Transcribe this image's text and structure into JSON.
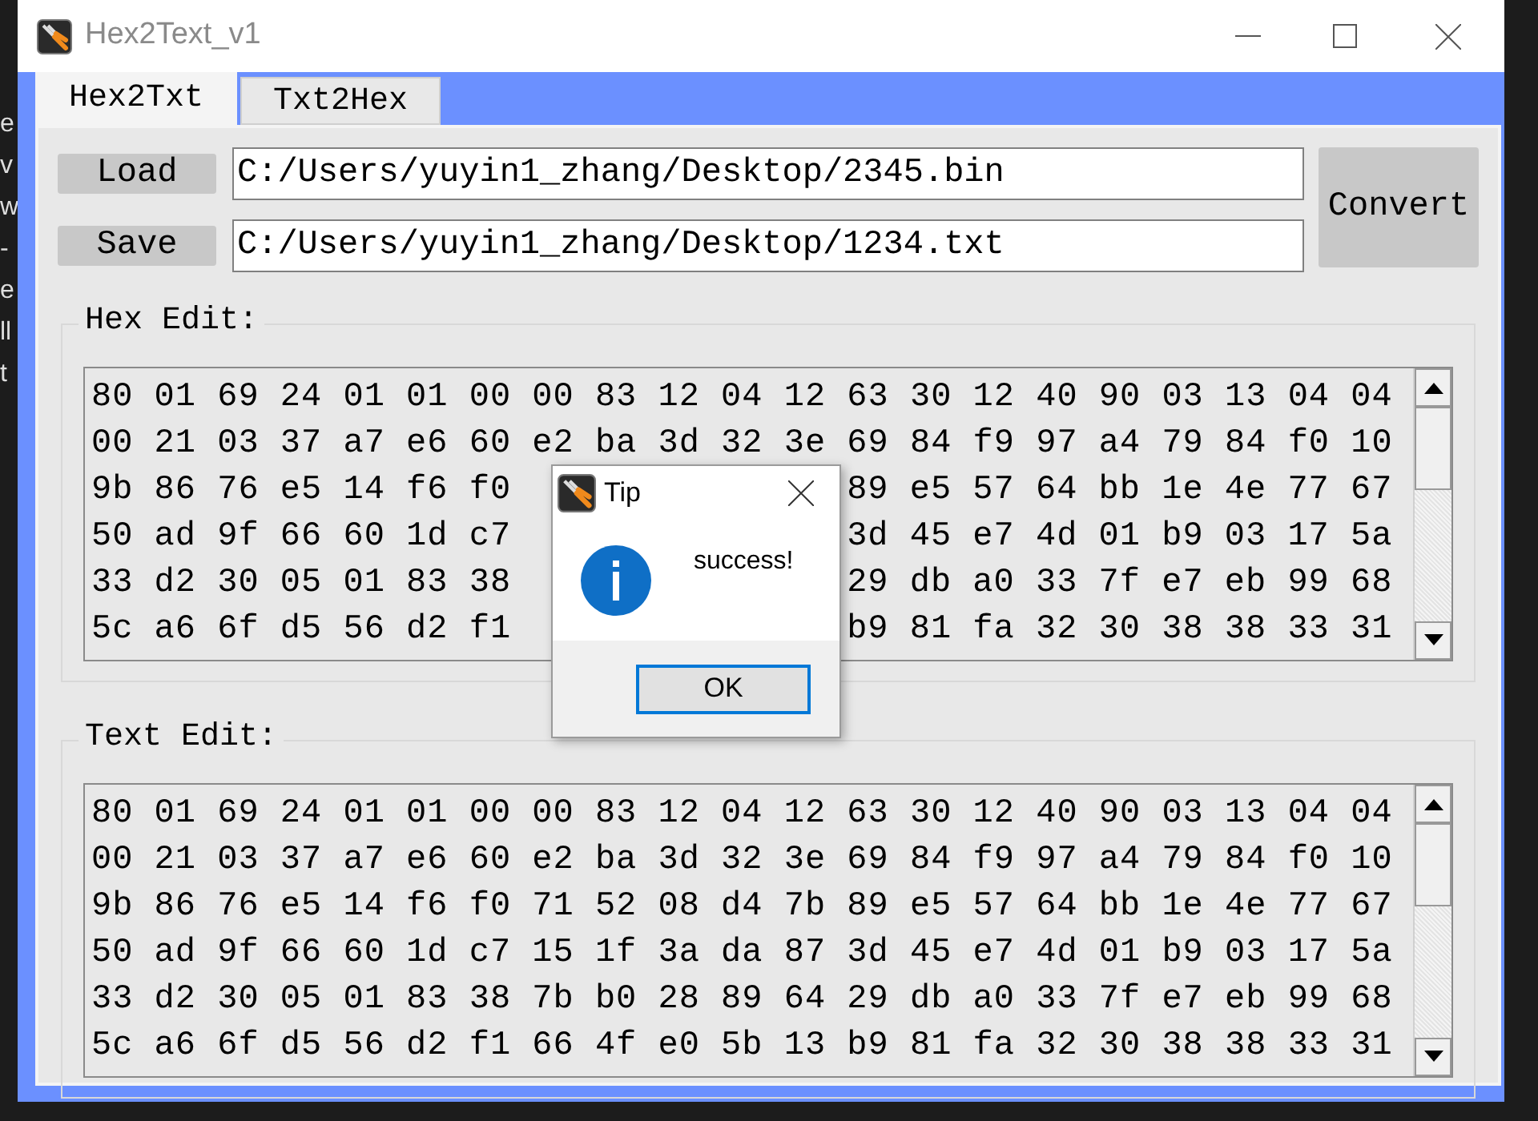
{
  "background_fragments": [
    "e",
    "v",
    "w",
    "-",
    "e",
    "ll",
    "t"
  ],
  "window": {
    "title": "Hex2Text_v1"
  },
  "tabs": [
    {
      "label": "Hex2Txt",
      "selected": true
    },
    {
      "label": "Txt2Hex",
      "selected": false
    }
  ],
  "file_rows": [
    {
      "button": "Load",
      "path": "C:/Users/yuyin1_zhang/Desktop/2345.bin"
    },
    {
      "button": "Save",
      "path": "C:/Users/yuyin1_zhang/Desktop/1234.txt"
    }
  ],
  "convert_button": "Convert",
  "hex_edit": {
    "label": "Hex Edit:",
    "rows": [
      {
        "segments": [
          "80 01 69 24 01 01 00 00 83 12 04 12 63 30 12 40 90 03 13 04 04"
        ]
      },
      {
        "segments": [
          "00 21 03 37 a7 e6 60 e2 ba 3d 32 3e 69 84 f9 97 a4 79 84 f0 10"
        ]
      },
      {
        "segments": [
          "9b 86 76 e5 14 f6 f0",
          "89 e5 57 64 bb 1e 4e 77 67"
        ]
      },
      {
        "segments": [
          "50 ad 9f 66 60 1d c7",
          "3d 45 e7 4d 01 b9 03 17 5a"
        ]
      },
      {
        "segments": [
          "33 d2 30 05 01 83 38",
          "29 db a0 33 7f e7 eb 99 68"
        ]
      },
      {
        "segments": [
          "5c a6 6f d5 56 d2 f1",
          "b9 81 fa 32 30 38 38 33 31"
        ]
      }
    ]
  },
  "text_edit": {
    "label": "Text Edit:",
    "rows": [
      {
        "segments": [
          "80 01 69 24 01 01 00 00 83 12 04 12 63 30 12 40 90 03 13 04 04"
        ]
      },
      {
        "segments": [
          "00 21 03 37 a7 e6 60 e2 ba 3d 32 3e 69 84 f9 97 a4 79 84 f0 10"
        ]
      },
      {
        "segments": [
          "9b 86 76 e5 14 f6 f0 71 52 08 d4 7b 89 e5 57 64 bb 1e 4e 77 67"
        ]
      },
      {
        "segments": [
          "50 ad 9f 66 60 1d c7 15 1f 3a da 87 3d 45 e7 4d 01 b9 03 17 5a"
        ]
      },
      {
        "segments": [
          "33 d2 30 05 01 83 38 7b b0 28 89 64 29 db a0 33 7f e7 eb 99 68"
        ]
      },
      {
        "segments": [
          "5c a6 6f d5 56 d2 f1 66 4f e0 5b 13 b9 81 fa 32 30 38 38 33 31"
        ]
      }
    ]
  },
  "dialog": {
    "title": "Tip",
    "message": "success!",
    "button": "OK"
  }
}
